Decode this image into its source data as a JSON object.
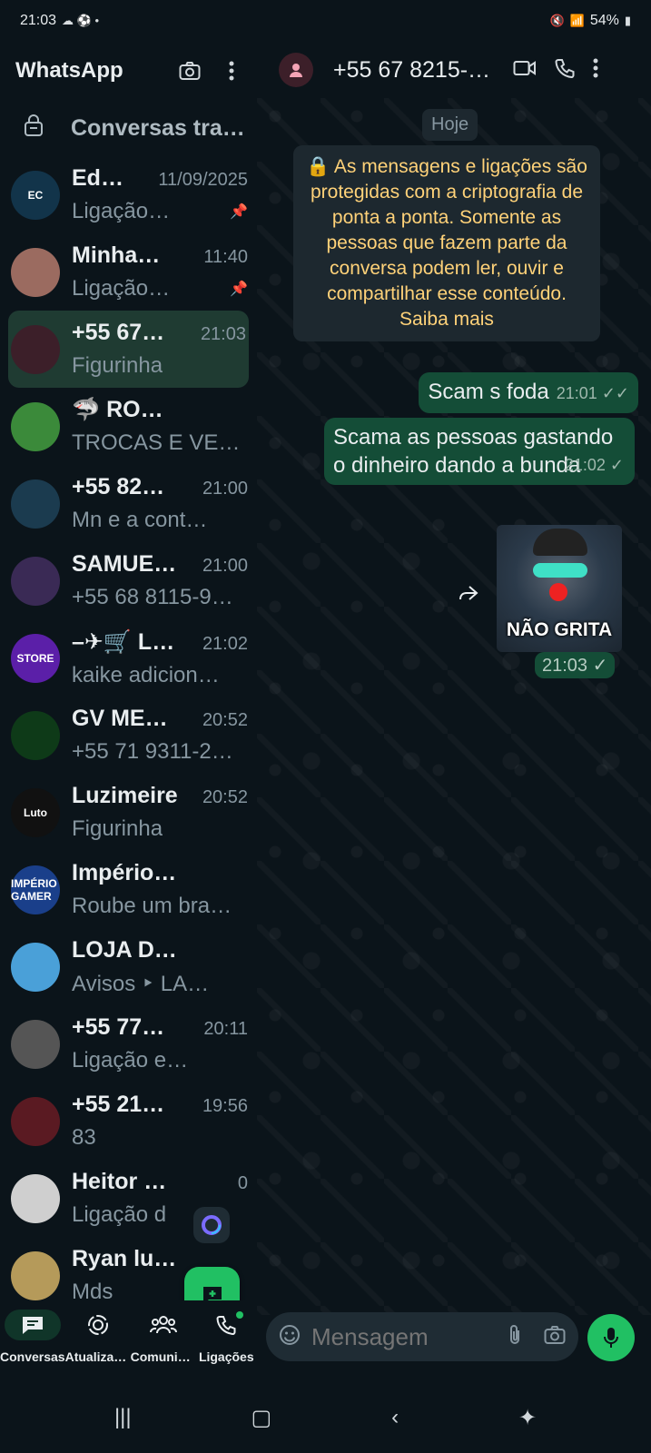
{
  "status_bar": {
    "time": "21:03",
    "battery": "54%"
  },
  "left": {
    "title": "WhatsApp",
    "archived_label": "Conversas trancadas",
    "chats": [
      {
        "name": "Ed…",
        "time": "11/09/2025",
        "preview": "Ligação…",
        "avatar_text": "EC",
        "avatar_color": "#12344a",
        "pinned": true
      },
      {
        "name": "Minha…",
        "time": "11:40",
        "preview": "Ligação…",
        "avatar_text": "",
        "avatar_color": "#9b6b60",
        "pinned": true
      },
      {
        "name": "+55 67…",
        "time": "21:03",
        "preview": "Figurinha",
        "avatar_text": "",
        "avatar_color": "#3c1f29",
        "selected": true
      },
      {
        "name": "🦈 ROUB…",
        "time": "",
        "preview": "TROCAS E VEN…",
        "avatar_text": "",
        "avatar_color": "#3b8a3a"
      },
      {
        "name": "+55 82…",
        "time": "21:00",
        "preview": "Mn e a cont…",
        "avatar_text": "",
        "avatar_color": "#1b3b4f"
      },
      {
        "name": "SAMUE…",
        "time": "21:00",
        "preview": "+55 68 8115-9…",
        "avatar_text": "",
        "avatar_color": "#3a2a55"
      },
      {
        "name": "–✈🛒 L…",
        "time": "21:02",
        "preview": "kaike adicion…",
        "avatar_text": "STORE",
        "avatar_color": "#5b1fa8"
      },
      {
        "name": "GV MET…",
        "time": "20:52",
        "preview": "+55 71 9311-2…",
        "avatar_text": "",
        "avatar_color": "#0e3a18"
      },
      {
        "name": "Luzimeire",
        "time": "20:52",
        "preview": "Figurinha",
        "avatar_text": "Luto",
        "avatar_color": "#111111"
      },
      {
        "name": "Império G…",
        "time": "",
        "preview": "Roube um bra…",
        "avatar_text": "IMPÉRIO GAMER",
        "avatar_color": "#1a3f8a"
      },
      {
        "name": "LOJA DE…",
        "time": "",
        "preview": "Avisos ‣ LA…",
        "avatar_text": "",
        "avatar_color": "#4aa0d8"
      },
      {
        "name": "+55 77…",
        "time": "20:11",
        "preview": "Ligação e…",
        "avatar_text": "",
        "avatar_color": "#555555"
      },
      {
        "name": "+55 21…",
        "time": "19:56",
        "preview": "83",
        "avatar_text": "",
        "avatar_color": "#5a1a22"
      },
      {
        "name": "Heitor C…",
        "time": "0",
        "preview": "Ligação d",
        "avatar_text": "",
        "avatar_color": "#cfcfcf"
      },
      {
        "name": "Ryan lu…",
        "time": "",
        "preview": "Mds",
        "avatar_text": "",
        "avatar_color": "#b59a5a"
      }
    ],
    "nav": [
      {
        "label": "Conversas",
        "active": true
      },
      {
        "label": "Atualizações"
      },
      {
        "label": "Comunidades"
      },
      {
        "label": "Ligações"
      }
    ]
  },
  "right": {
    "contact_name": "+55 67 8215-…",
    "date_chip": "Hoje",
    "e2e_note": "🔒 As mensagens e ligações são protegidas com a criptografia de ponta a ponta. Somente as pessoas que fazem parte da conversa podem ler, ouvir e compartilhar esse conteúdo. Saiba mais",
    "messages": [
      {
        "text": "Scam s foda",
        "time": "21:01",
        "ticks": "✓✓"
      },
      {
        "text": "Scama as pessoas gastando o dinheiro dando a bunda",
        "time": "21:02",
        "ticks": "✓"
      }
    ],
    "sticker": {
      "caption": "NÃO GRITA",
      "time": "21:03",
      "ticks": "✓"
    },
    "composer_placeholder": "Mensagem"
  }
}
